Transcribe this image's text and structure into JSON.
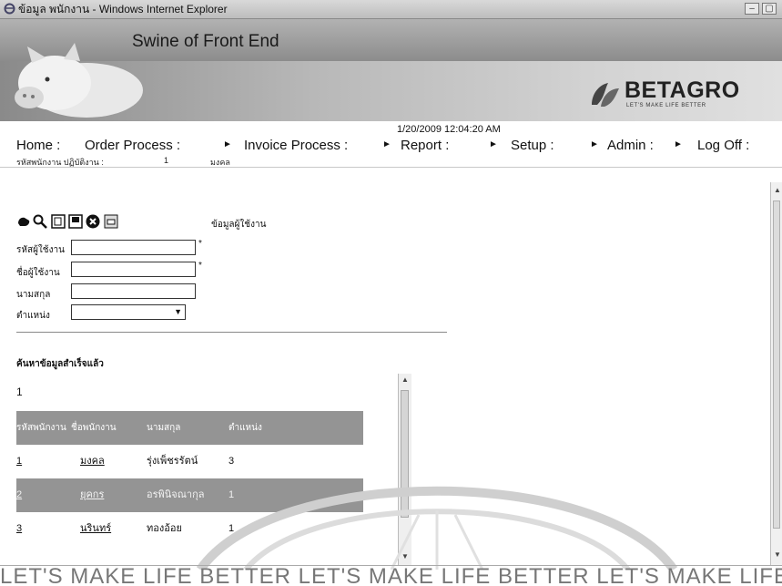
{
  "window": {
    "title": "ข้อมูล พนักงาน - Windows Internet Explorer",
    "minimize": "–",
    "maximize": "▢"
  },
  "banner": {
    "app_title": "Swine of Front End",
    "brand": "BETAGRO",
    "tagline": "LET'S MAKE LIFE BETTER"
  },
  "datetime": "1/20/2009 12:04:20 AM",
  "menu": {
    "items": [
      {
        "label": "Home :"
      },
      {
        "label": "Order Process :"
      },
      {
        "label": "Invoice Process :"
      },
      {
        "label": "Report :"
      },
      {
        "label": "Setup :"
      },
      {
        "label": "Admin :"
      },
      {
        "label": "Log Off :"
      }
    ],
    "arrow": "►"
  },
  "user_info": {
    "label": "รหัสพนักงาน ปฏิบัติงาน :",
    "value": "1",
    "name": "มงคล"
  },
  "toolbar": {
    "icons": [
      "hand-icon",
      "search-icon",
      "new-icon",
      "save-icon",
      "delete-icon",
      "print-icon"
    ]
  },
  "form": {
    "title": "ข้อมูลผู้ใช้งาน",
    "fields": [
      {
        "label": "รหัสผู้ใช้งาน",
        "value": "",
        "required": "*"
      },
      {
        "label": "ชื่อผู้ใช้งาน",
        "value": "",
        "required": "*"
      },
      {
        "label": "นามสกุล",
        "value": ""
      },
      {
        "label": "ตำแหน่ง",
        "value": ""
      }
    ]
  },
  "search": {
    "title": "ค้นหาข้อมูลสำเร็จแล้ว",
    "result_count": "1"
  },
  "table": {
    "headers": [
      "รหัสพนักงาน",
      "ชื่อพนักงาน",
      "นามสกุล",
      "ตำแหน่ง"
    ],
    "rows": [
      [
        "1",
        "มงคล",
        "รุ่งเพ็ชรรัตน์",
        "3"
      ],
      [
        "2",
        "ยุคกร",
        "อรพินิจณากุล",
        "1"
      ],
      [
        "3",
        "นรินทร์",
        "ทองอ้อย",
        "1"
      ]
    ]
  },
  "footer_text": "LET'S MAKE LIFE BETTER  LET'S MAKE LIFE BETTER  LET'S MAKE LIFE BETTER",
  "colors": {
    "banner": "#9a9a9a",
    "grid_header": "#949494",
    "grid_alt": "#949494"
  }
}
